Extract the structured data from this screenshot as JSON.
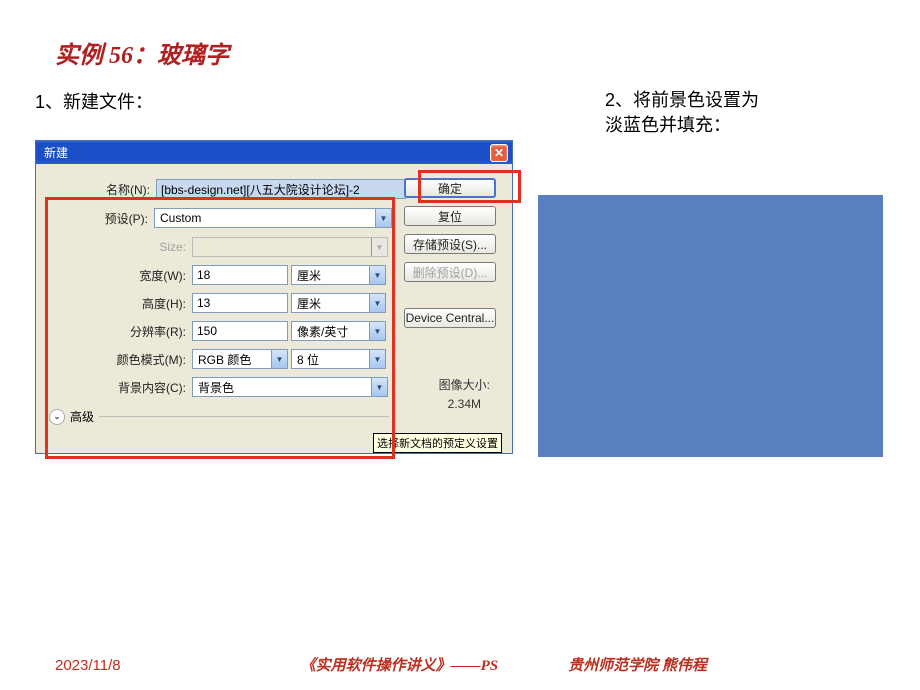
{
  "slide": {
    "title": "实例 56：玻璃字",
    "step1": "1、新建文件：",
    "step2": "2、将前景色设置为淡蓝色并填充："
  },
  "dialog": {
    "title": "新建",
    "name_label": "名称(N):",
    "name_value": "[bbs-design.net][八五大院设计论坛]-2",
    "preset_label": "预设(P):",
    "preset_value": "Custom",
    "size_label": "Size:",
    "width_label": "宽度(W):",
    "width_value": "18",
    "width_unit": "厘米",
    "height_label": "高度(H):",
    "height_value": "13",
    "height_unit": "厘米",
    "res_label": "分辨率(R):",
    "res_value": "150",
    "res_unit": "像素/英寸",
    "mode_label": "颜色模式(M):",
    "mode_value": "RGB 颜色",
    "mode_bit": "8 位",
    "bg_label": "背景内容(C):",
    "bg_value": "背景色",
    "advanced": "高级",
    "imgsize_label": "图像大小:",
    "imgsize_value": "2.34M",
    "tooltip": "选择新文档的预定义设置"
  },
  "buttons": {
    "ok": "确定",
    "reset": "复位",
    "save_preset": "存储预设(S)...",
    "delete_preset": "删除预设(D)...",
    "device_central": "Device Central..."
  },
  "footer": {
    "date": "2023/11/8",
    "center": "《实用软件操作讲义》——PS",
    "right": "贵州师范学院  熊伟程"
  }
}
